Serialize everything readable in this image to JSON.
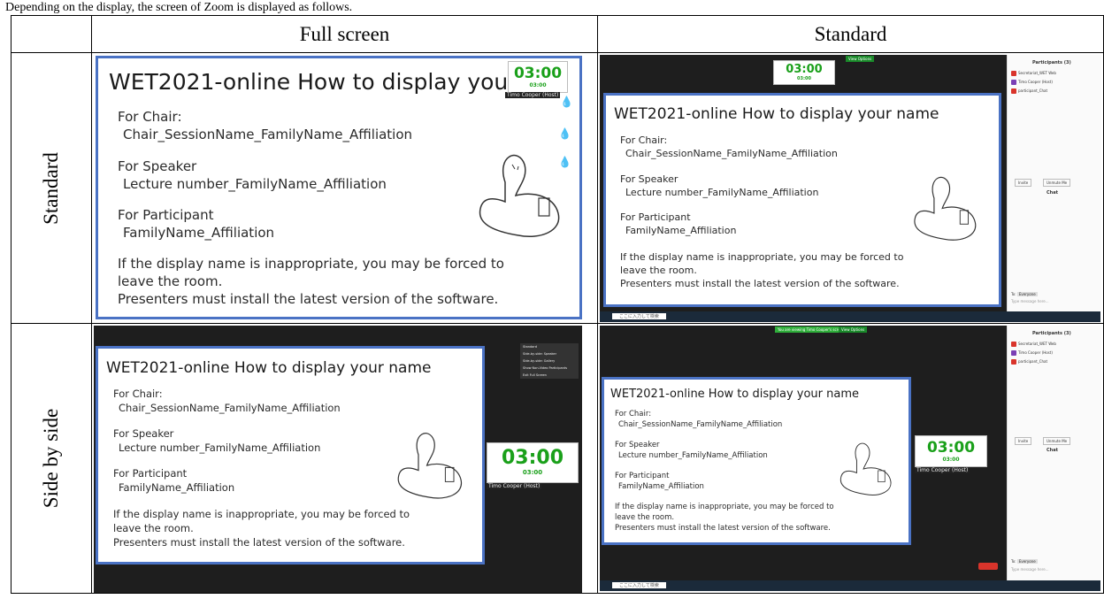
{
  "caption": "Depending on the display, the screen of Zoom is displayed as follows.",
  "table": {
    "col_full": "Full screen",
    "col_standard": "Standard",
    "row_standard": "Standard",
    "row_side": "Side by side"
  },
  "slide": {
    "title": "WET2021-online How to display your name",
    "title_cut": "WET2021-online How to display your n",
    "chair_head": "For Chair:",
    "chair_val": "Chair_SessionName_FamilyName_Affiliation",
    "speaker_head": "For Speaker",
    "speaker_val": "Lecture number_FamilyName_Affiliation",
    "participant_head": "For Participant",
    "participant_val": "FamilyName_Affiliation",
    "note1": "If the display name is inappropriate, you may be forced to",
    "note2": "leave the room.",
    "note3": "Presenters must install the latest version of the software."
  },
  "timer": {
    "big": "03:00",
    "small": "03:00"
  },
  "zoom": {
    "participants_title": "Participants (3)",
    "p1": "Secretariat_WET Web",
    "p2": "Timo Cooper (Host)",
    "p3": "participant_Chat",
    "chat_title": "Chat",
    "invite": "Invite",
    "unmute": "Unmute Me",
    "to_label": "To:",
    "to_value": "Everyone",
    "chat_placeholder": "Type message here...",
    "view_options": "View Options",
    "viewing": "You are viewing Timo Cooper's screen",
    "menu": [
      "Standard",
      "Side-by-side: Speaker",
      "Side-by-side: Gallery",
      "Show Non-Video Participants",
      "Exit Full Screen"
    ],
    "search": "ここに入力して検索"
  },
  "colors": {
    "slide_border": "#4a72c4",
    "timer_green": "#1aa01a",
    "zoom_dark": "#1e1e1e",
    "taskbar": "#1b2a3a"
  }
}
